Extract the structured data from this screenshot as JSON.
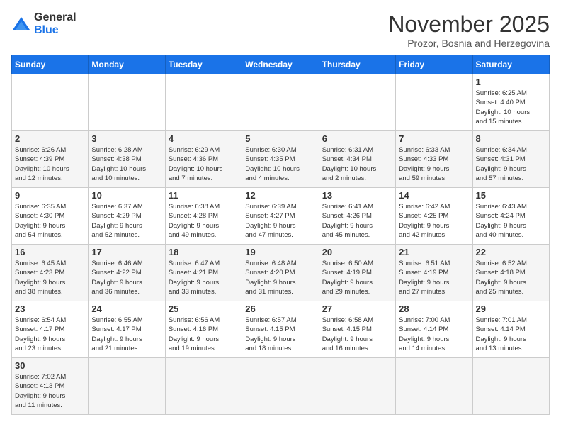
{
  "logo": {
    "line1": "General",
    "line2": "Blue"
  },
  "header": {
    "month": "November 2025",
    "location": "Prozor, Bosnia and Herzegovina"
  },
  "weekdays": [
    "Sunday",
    "Monday",
    "Tuesday",
    "Wednesday",
    "Thursday",
    "Friday",
    "Saturday"
  ],
  "weeks": [
    [
      {
        "day": "",
        "info": ""
      },
      {
        "day": "",
        "info": ""
      },
      {
        "day": "",
        "info": ""
      },
      {
        "day": "",
        "info": ""
      },
      {
        "day": "",
        "info": ""
      },
      {
        "day": "",
        "info": ""
      },
      {
        "day": "1",
        "info": "Sunrise: 6:25 AM\nSunset: 4:40 PM\nDaylight: 10 hours\nand 15 minutes."
      }
    ],
    [
      {
        "day": "2",
        "info": "Sunrise: 6:26 AM\nSunset: 4:39 PM\nDaylight: 10 hours\nand 12 minutes."
      },
      {
        "day": "3",
        "info": "Sunrise: 6:28 AM\nSunset: 4:38 PM\nDaylight: 10 hours\nand 10 minutes."
      },
      {
        "day": "4",
        "info": "Sunrise: 6:29 AM\nSunset: 4:36 PM\nDaylight: 10 hours\nand 7 minutes."
      },
      {
        "day": "5",
        "info": "Sunrise: 6:30 AM\nSunset: 4:35 PM\nDaylight: 10 hours\nand 4 minutes."
      },
      {
        "day": "6",
        "info": "Sunrise: 6:31 AM\nSunset: 4:34 PM\nDaylight: 10 hours\nand 2 minutes."
      },
      {
        "day": "7",
        "info": "Sunrise: 6:33 AM\nSunset: 4:33 PM\nDaylight: 9 hours\nand 59 minutes."
      },
      {
        "day": "8",
        "info": "Sunrise: 6:34 AM\nSunset: 4:31 PM\nDaylight: 9 hours\nand 57 minutes."
      }
    ],
    [
      {
        "day": "9",
        "info": "Sunrise: 6:35 AM\nSunset: 4:30 PM\nDaylight: 9 hours\nand 54 minutes."
      },
      {
        "day": "10",
        "info": "Sunrise: 6:37 AM\nSunset: 4:29 PM\nDaylight: 9 hours\nand 52 minutes."
      },
      {
        "day": "11",
        "info": "Sunrise: 6:38 AM\nSunset: 4:28 PM\nDaylight: 9 hours\nand 49 minutes."
      },
      {
        "day": "12",
        "info": "Sunrise: 6:39 AM\nSunset: 4:27 PM\nDaylight: 9 hours\nand 47 minutes."
      },
      {
        "day": "13",
        "info": "Sunrise: 6:41 AM\nSunset: 4:26 PM\nDaylight: 9 hours\nand 45 minutes."
      },
      {
        "day": "14",
        "info": "Sunrise: 6:42 AM\nSunset: 4:25 PM\nDaylight: 9 hours\nand 42 minutes."
      },
      {
        "day": "15",
        "info": "Sunrise: 6:43 AM\nSunset: 4:24 PM\nDaylight: 9 hours\nand 40 minutes."
      }
    ],
    [
      {
        "day": "16",
        "info": "Sunrise: 6:45 AM\nSunset: 4:23 PM\nDaylight: 9 hours\nand 38 minutes."
      },
      {
        "day": "17",
        "info": "Sunrise: 6:46 AM\nSunset: 4:22 PM\nDaylight: 9 hours\nand 36 minutes."
      },
      {
        "day": "18",
        "info": "Sunrise: 6:47 AM\nSunset: 4:21 PM\nDaylight: 9 hours\nand 33 minutes."
      },
      {
        "day": "19",
        "info": "Sunrise: 6:48 AM\nSunset: 4:20 PM\nDaylight: 9 hours\nand 31 minutes."
      },
      {
        "day": "20",
        "info": "Sunrise: 6:50 AM\nSunset: 4:19 PM\nDaylight: 9 hours\nand 29 minutes."
      },
      {
        "day": "21",
        "info": "Sunrise: 6:51 AM\nSunset: 4:19 PM\nDaylight: 9 hours\nand 27 minutes."
      },
      {
        "day": "22",
        "info": "Sunrise: 6:52 AM\nSunset: 4:18 PM\nDaylight: 9 hours\nand 25 minutes."
      }
    ],
    [
      {
        "day": "23",
        "info": "Sunrise: 6:54 AM\nSunset: 4:17 PM\nDaylight: 9 hours\nand 23 minutes."
      },
      {
        "day": "24",
        "info": "Sunrise: 6:55 AM\nSunset: 4:17 PM\nDaylight: 9 hours\nand 21 minutes."
      },
      {
        "day": "25",
        "info": "Sunrise: 6:56 AM\nSunset: 4:16 PM\nDaylight: 9 hours\nand 19 minutes."
      },
      {
        "day": "26",
        "info": "Sunrise: 6:57 AM\nSunset: 4:15 PM\nDaylight: 9 hours\nand 18 minutes."
      },
      {
        "day": "27",
        "info": "Sunrise: 6:58 AM\nSunset: 4:15 PM\nDaylight: 9 hours\nand 16 minutes."
      },
      {
        "day": "28",
        "info": "Sunrise: 7:00 AM\nSunset: 4:14 PM\nDaylight: 9 hours\nand 14 minutes."
      },
      {
        "day": "29",
        "info": "Sunrise: 7:01 AM\nSunset: 4:14 PM\nDaylight: 9 hours\nand 13 minutes."
      }
    ],
    [
      {
        "day": "30",
        "info": "Sunrise: 7:02 AM\nSunset: 4:13 PM\nDaylight: 9 hours\nand 11 minutes."
      },
      {
        "day": "",
        "info": ""
      },
      {
        "day": "",
        "info": ""
      },
      {
        "day": "",
        "info": ""
      },
      {
        "day": "",
        "info": ""
      },
      {
        "day": "",
        "info": ""
      },
      {
        "day": "",
        "info": ""
      }
    ]
  ]
}
